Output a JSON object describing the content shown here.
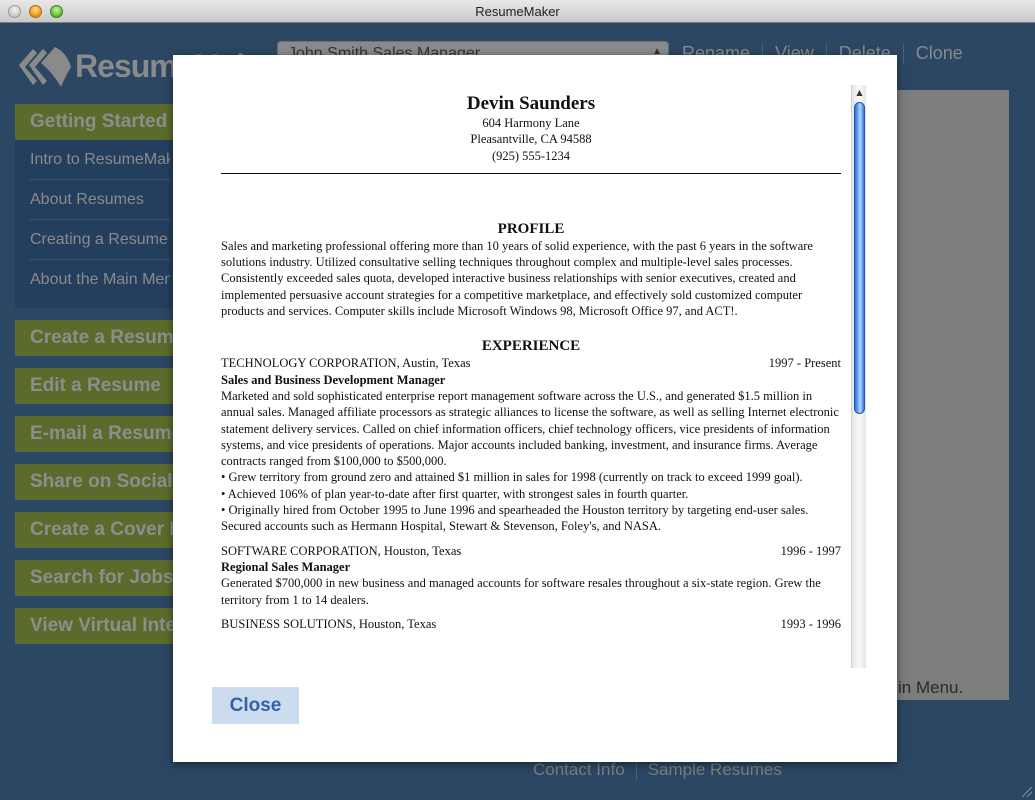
{
  "window": {
    "title": "ResumeMaker"
  },
  "header": {
    "logo_text": "ResumeMaker",
    "resume_select_value": "John Smith Sales Manager",
    "actions": [
      "Rename",
      "View",
      "Delete",
      "Clone"
    ]
  },
  "sidebar": {
    "getting_started": {
      "label": "Getting Started",
      "items": [
        "Intro to ResumeMaker",
        "About Resumes",
        "Creating a Resume",
        "About the Main Menu"
      ]
    },
    "nav_buttons": [
      "Create a Resume",
      "Edit a Resume",
      "E-mail a Resume",
      "Share on Social Media",
      "Create a Cover Letter",
      "Search for Jobs",
      "View Virtual Interview"
    ]
  },
  "content_panel": {
    "visible_text": "in Menu."
  },
  "footer": {
    "links": [
      "Contact Info",
      "Sample Resumes"
    ]
  },
  "modal": {
    "close_label": "Close",
    "resume": {
      "name": "Devin Saunders",
      "address1": "604 Harmony Lane",
      "address2": "Pleasantville, CA 94588",
      "phone": "(925) 555-1234",
      "profile_title": "PROFILE",
      "profile_text": "Sales and marketing professional offering more than 10 years of solid experience, with the past 6 years in the software solutions industry. Utilized consultative selling techniques throughout complex and multiple-level sales processes. Consistently exceeded sales quota, developed interactive business relationships with senior executives, created and implemented persuasive account strategies for a competitive marketplace, and effectively sold customized computer products and services. Computer skills include Microsoft Windows 98, Microsoft Office 97, and ACT!.",
      "experience_title": "EXPERIENCE",
      "jobs": [
        {
          "company": "TECHNOLOGY CORPORATION, Austin, Texas",
          "dates": "1997 - Present",
          "title": "Sales and Business Development Manager",
          "description": "Marketed and sold sophisticated enterprise report management software across the U.S., and generated $1.5 million in annual sales. Managed affiliate processors as strategic alliances to license the software, as well as selling Internet electronic statement delivery services. Called on chief information officers, chief technology officers, vice presidents of information systems, and vice presidents of operations. Major accounts included banking, investment, and insurance firms. Average contracts ranged from $100,000 to $500,000.",
          "bullets": [
            "• Grew territory from ground zero and attained $1 million in sales for 1998 (currently on track to exceed 1999 goal).",
            "• Achieved 106% of plan year-to-date after first quarter, with strongest sales in fourth quarter.",
            "• Originally hired from October 1995 to June 1996 and spearheaded the Houston territory by targeting end-user sales. Secured accounts such as Hermann Hospital, Stewart & Stevenson, Foley's, and NASA."
          ]
        },
        {
          "company": "SOFTWARE CORPORATION, Houston, Texas",
          "dates": "1996 - 1997",
          "title": "Regional Sales Manager",
          "description": "Generated $700,000 in new business and managed accounts for software resales throughout a six-state region. Grew the territory from 1 to 14 dealers."
        },
        {
          "company": "BUSINESS SOLUTIONS, Houston, Texas",
          "dates": "1993 - 1996"
        }
      ]
    }
  }
}
